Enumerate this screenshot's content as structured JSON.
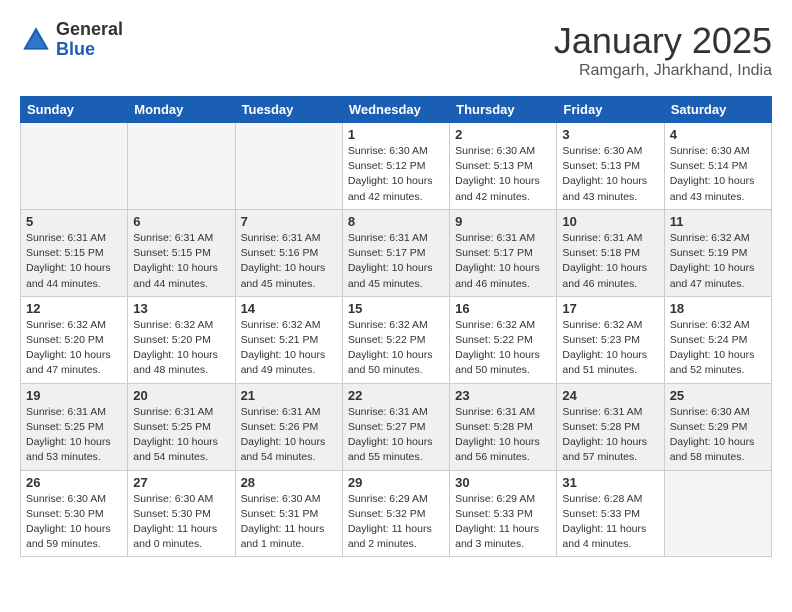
{
  "logo": {
    "general": "General",
    "blue": "Blue"
  },
  "calendar": {
    "title": "January 2025",
    "subtitle": "Ramgarh, Jharkhand, India",
    "days_of_week": [
      "Sunday",
      "Monday",
      "Tuesday",
      "Wednesday",
      "Thursday",
      "Friday",
      "Saturday"
    ],
    "weeks": [
      [
        {
          "day": "",
          "info": ""
        },
        {
          "day": "",
          "info": ""
        },
        {
          "day": "",
          "info": ""
        },
        {
          "day": "1",
          "info": "Sunrise: 6:30 AM\nSunset: 5:12 PM\nDaylight: 10 hours\nand 42 minutes."
        },
        {
          "day": "2",
          "info": "Sunrise: 6:30 AM\nSunset: 5:13 PM\nDaylight: 10 hours\nand 42 minutes."
        },
        {
          "day": "3",
          "info": "Sunrise: 6:30 AM\nSunset: 5:13 PM\nDaylight: 10 hours\nand 43 minutes."
        },
        {
          "day": "4",
          "info": "Sunrise: 6:30 AM\nSunset: 5:14 PM\nDaylight: 10 hours\nand 43 minutes."
        }
      ],
      [
        {
          "day": "5",
          "info": "Sunrise: 6:31 AM\nSunset: 5:15 PM\nDaylight: 10 hours\nand 44 minutes."
        },
        {
          "day": "6",
          "info": "Sunrise: 6:31 AM\nSunset: 5:15 PM\nDaylight: 10 hours\nand 44 minutes."
        },
        {
          "day": "7",
          "info": "Sunrise: 6:31 AM\nSunset: 5:16 PM\nDaylight: 10 hours\nand 45 minutes."
        },
        {
          "day": "8",
          "info": "Sunrise: 6:31 AM\nSunset: 5:17 PM\nDaylight: 10 hours\nand 45 minutes."
        },
        {
          "day": "9",
          "info": "Sunrise: 6:31 AM\nSunset: 5:17 PM\nDaylight: 10 hours\nand 46 minutes."
        },
        {
          "day": "10",
          "info": "Sunrise: 6:31 AM\nSunset: 5:18 PM\nDaylight: 10 hours\nand 46 minutes."
        },
        {
          "day": "11",
          "info": "Sunrise: 6:32 AM\nSunset: 5:19 PM\nDaylight: 10 hours\nand 47 minutes."
        }
      ],
      [
        {
          "day": "12",
          "info": "Sunrise: 6:32 AM\nSunset: 5:20 PM\nDaylight: 10 hours\nand 47 minutes."
        },
        {
          "day": "13",
          "info": "Sunrise: 6:32 AM\nSunset: 5:20 PM\nDaylight: 10 hours\nand 48 minutes."
        },
        {
          "day": "14",
          "info": "Sunrise: 6:32 AM\nSunset: 5:21 PM\nDaylight: 10 hours\nand 49 minutes."
        },
        {
          "day": "15",
          "info": "Sunrise: 6:32 AM\nSunset: 5:22 PM\nDaylight: 10 hours\nand 50 minutes."
        },
        {
          "day": "16",
          "info": "Sunrise: 6:32 AM\nSunset: 5:22 PM\nDaylight: 10 hours\nand 50 minutes."
        },
        {
          "day": "17",
          "info": "Sunrise: 6:32 AM\nSunset: 5:23 PM\nDaylight: 10 hours\nand 51 minutes."
        },
        {
          "day": "18",
          "info": "Sunrise: 6:32 AM\nSunset: 5:24 PM\nDaylight: 10 hours\nand 52 minutes."
        }
      ],
      [
        {
          "day": "19",
          "info": "Sunrise: 6:31 AM\nSunset: 5:25 PM\nDaylight: 10 hours\nand 53 minutes."
        },
        {
          "day": "20",
          "info": "Sunrise: 6:31 AM\nSunset: 5:25 PM\nDaylight: 10 hours\nand 54 minutes."
        },
        {
          "day": "21",
          "info": "Sunrise: 6:31 AM\nSunset: 5:26 PM\nDaylight: 10 hours\nand 54 minutes."
        },
        {
          "day": "22",
          "info": "Sunrise: 6:31 AM\nSunset: 5:27 PM\nDaylight: 10 hours\nand 55 minutes."
        },
        {
          "day": "23",
          "info": "Sunrise: 6:31 AM\nSunset: 5:28 PM\nDaylight: 10 hours\nand 56 minutes."
        },
        {
          "day": "24",
          "info": "Sunrise: 6:31 AM\nSunset: 5:28 PM\nDaylight: 10 hours\nand 57 minutes."
        },
        {
          "day": "25",
          "info": "Sunrise: 6:30 AM\nSunset: 5:29 PM\nDaylight: 10 hours\nand 58 minutes."
        }
      ],
      [
        {
          "day": "26",
          "info": "Sunrise: 6:30 AM\nSunset: 5:30 PM\nDaylight: 10 hours\nand 59 minutes."
        },
        {
          "day": "27",
          "info": "Sunrise: 6:30 AM\nSunset: 5:30 PM\nDaylight: 11 hours\nand 0 minutes."
        },
        {
          "day": "28",
          "info": "Sunrise: 6:30 AM\nSunset: 5:31 PM\nDaylight: 11 hours\nand 1 minute."
        },
        {
          "day": "29",
          "info": "Sunrise: 6:29 AM\nSunset: 5:32 PM\nDaylight: 11 hours\nand 2 minutes."
        },
        {
          "day": "30",
          "info": "Sunrise: 6:29 AM\nSunset: 5:33 PM\nDaylight: 11 hours\nand 3 minutes."
        },
        {
          "day": "31",
          "info": "Sunrise: 6:28 AM\nSunset: 5:33 PM\nDaylight: 11 hours\nand 4 minutes."
        },
        {
          "day": "",
          "info": ""
        }
      ]
    ]
  }
}
